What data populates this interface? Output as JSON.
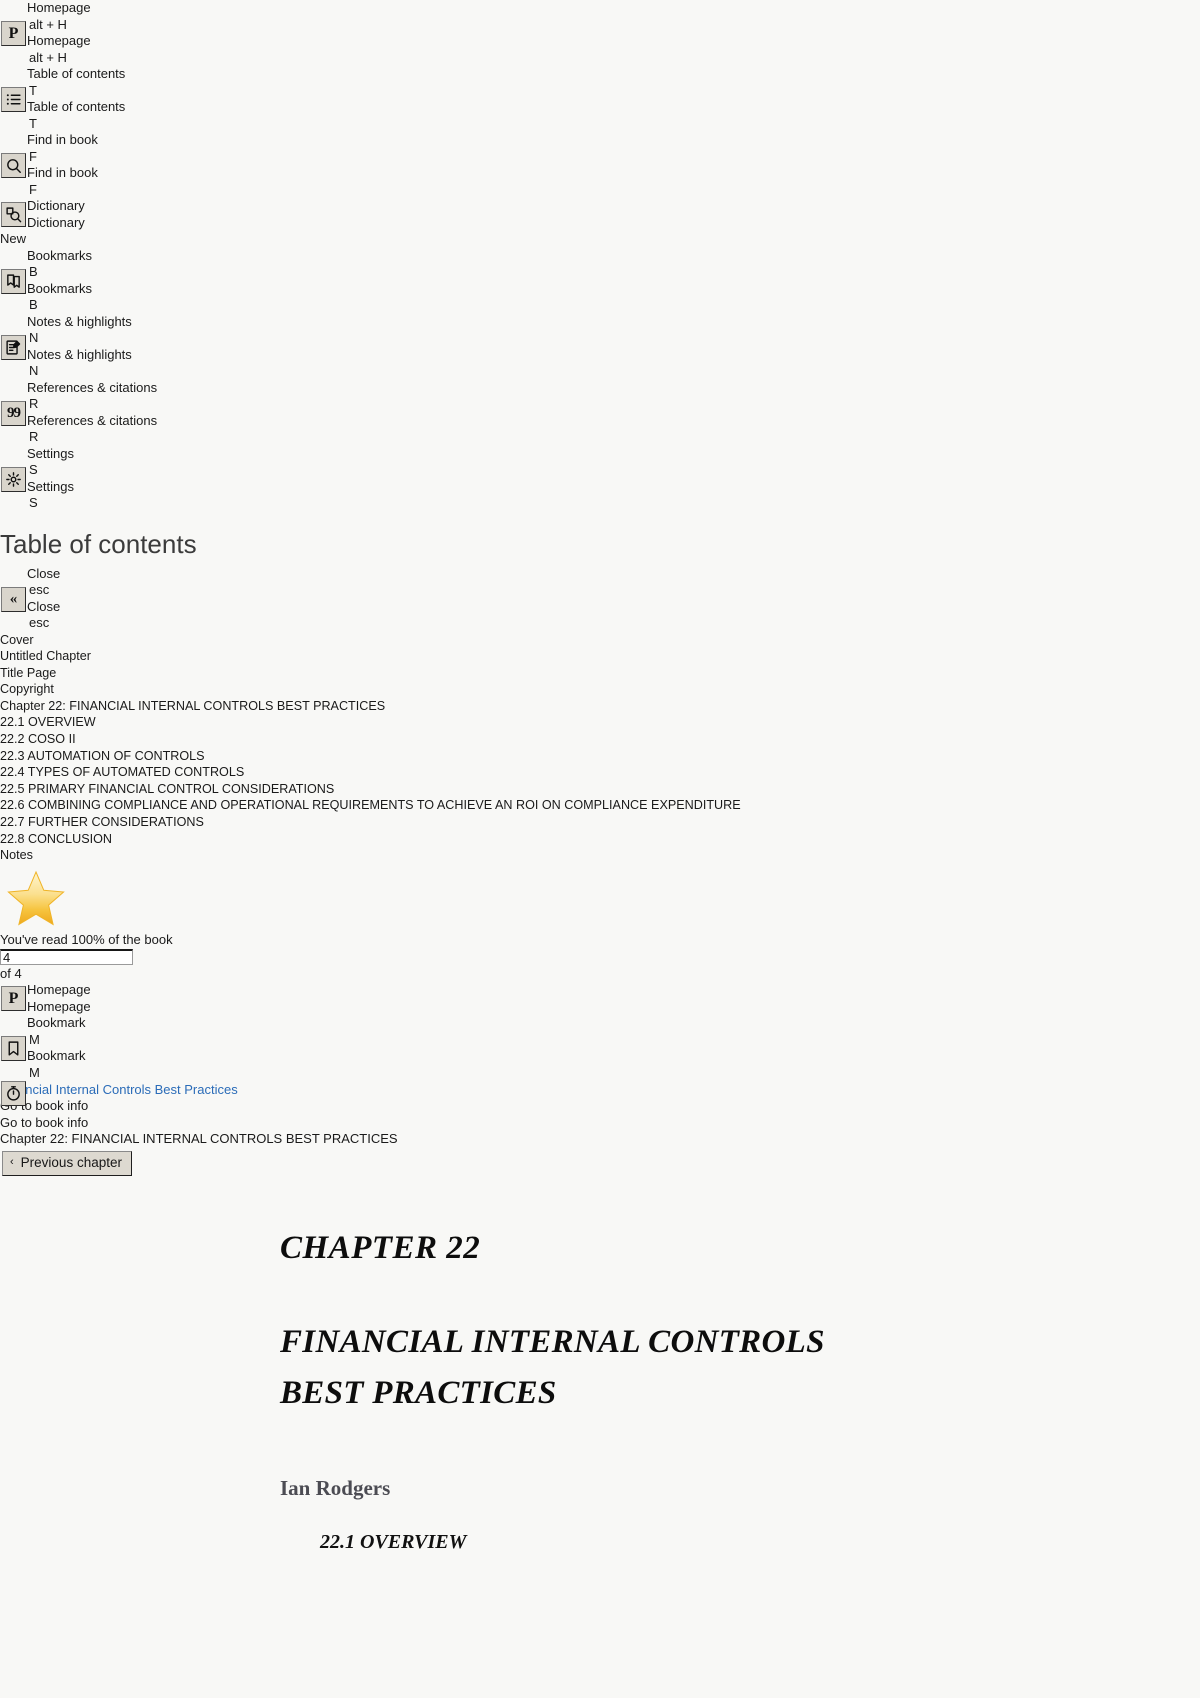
{
  "sidebar_tools": [
    {
      "icon": "perlego-logo-icon",
      "glyph": "P",
      "label": "Homepage",
      "shortcut": "alt + H",
      "lines": [
        "Homepage",
        "alt + H",
        "Homepage",
        "alt + H"
      ]
    },
    {
      "icon": "table-of-contents-icon",
      "glyph": "",
      "label": "Table of contents",
      "shortcut": "T",
      "lines": [
        "Table of contents",
        "T",
        "Table of contents",
        "T"
      ]
    },
    {
      "icon": "search-icon",
      "glyph": "",
      "label": "Find in book",
      "shortcut": "F",
      "lines": [
        "Find in book",
        "F",
        "Find in book",
        "F"
      ]
    },
    {
      "icon": "dictionary-icon",
      "glyph": "",
      "label": "Dictionary",
      "shortcut": "",
      "lines": [
        "Dictionary",
        "Dictionary"
      ]
    },
    {
      "icon": "bookmarks-icon",
      "glyph": "",
      "label": "Bookmarks",
      "shortcut": "B",
      "lines": [
        "Bookmarks",
        "B",
        "Bookmarks",
        "B"
      ]
    },
    {
      "icon": "notes-highlights-icon",
      "glyph": "",
      "label": "Notes & highlights",
      "shortcut": "N",
      "lines": [
        "Notes & highlights",
        "N",
        "Notes & highlights",
        "N"
      ]
    },
    {
      "icon": "references-citations-icon",
      "glyph": "99",
      "label": "References & citations",
      "shortcut": "R",
      "lines": [
        "References & citations",
        "R",
        "References & citations",
        "R"
      ]
    },
    {
      "icon": "settings-gear-icon",
      "glyph": "",
      "label": "Settings",
      "shortcut": "S",
      "lines": [
        "Settings",
        "S",
        "Settings",
        "S"
      ]
    }
  ],
  "new_badge": "New",
  "toc": {
    "heading": "Table of contents",
    "close_lines": [
      "Close",
      "esc",
      "Close",
      "esc"
    ],
    "close_label": "Close",
    "close_shortcut": "esc",
    "entries": [
      "Cover",
      "Untitled Chapter",
      "Title Page",
      "Copyright",
      "Chapter 22: FINANCIAL INTERNAL CONTROLS BEST PRACTICES",
      "22.1 OVERVIEW",
      "22.2 COSO II",
      "22.3 AUTOMATION OF CONTROLS",
      "22.4 TYPES OF AUTOMATED CONTROLS",
      "22.5 PRIMARY FINANCIAL CONTROL CONSIDERATIONS",
      "22.6 COMBINING COMPLIANCE AND OPERATIONAL REQUIREMENTS TO ACHIEVE AN ROI ON COMPLIANCE EXPENDITURE",
      "22.7 FURTHER CONSIDERATIONS",
      "22.8 CONCLUSION",
      "Notes"
    ]
  },
  "progress": {
    "star_icon": "star-icon",
    "read_message": "You've read 100% of the book",
    "percent": "100%",
    "current_page_value": "4",
    "page_placeholder": "",
    "total_pages_label": "of 4"
  },
  "bottom_tools": [
    {
      "icon": "perlego-logo-icon",
      "glyph": "P",
      "label": "Homepage",
      "shortcut": "",
      "lines": [
        "Homepage",
        "Homepage"
      ]
    },
    {
      "icon": "bookmark-icon",
      "glyph": "",
      "label": "Bookmark",
      "shortcut": "M",
      "lines": [
        "Bookmark",
        "M",
        "Bookmark",
        "M"
      ]
    },
    {
      "icon": "reading-timer-icon",
      "glyph": "",
      "label": "",
      "shortcut": "",
      "lines": []
    }
  ],
  "breadcrumb": {
    "book_link": "Financial Internal Controls Best Practices",
    "book_info_lines": [
      "Go to book info",
      "Go to book info"
    ],
    "chapter_label": "Chapter 22: FINANCIAL INTERNAL CONTROLS BEST PRACTICES",
    "previous_chapter_label": "Previous chapter",
    "previous_chapter_chevron": "‹"
  },
  "book_page": {
    "chapter_number": "CHAPTER 22",
    "chapter_title": "FINANCIAL INTERNAL CONTROLS BEST PRACTICES",
    "author": "Ian Rodgers",
    "section_heading": "22.1 OVERVIEW"
  },
  "colors": {
    "page_background": "#f8f8f6",
    "link_blue": "#2b6cb8",
    "button_face": "#d9d5cc",
    "star_gold": "#f5c244",
    "author_gray": "#4c4c53"
  }
}
